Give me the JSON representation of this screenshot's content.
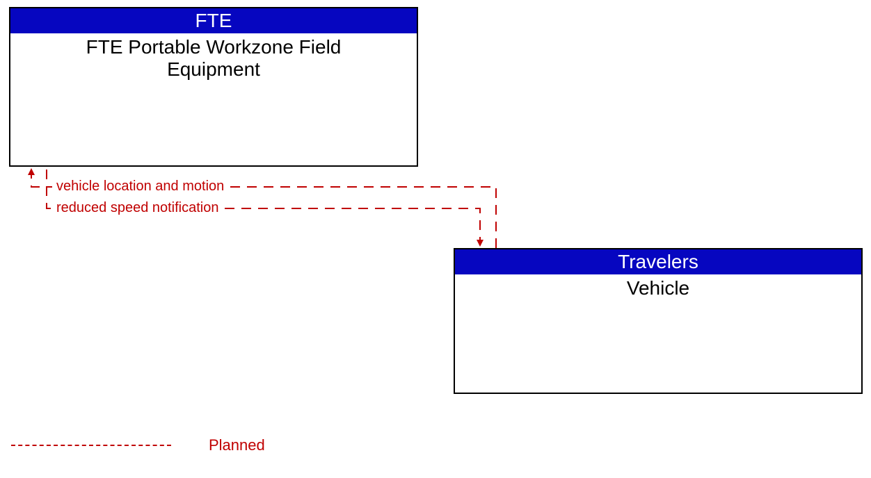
{
  "box1": {
    "header": "FTE",
    "body_line1": "FTE Portable Workzone Field",
    "body_line2": "Equipment"
  },
  "box2": {
    "header": "Travelers",
    "body": "Vehicle"
  },
  "flows": {
    "flow_up": "vehicle location and motion",
    "flow_down": "reduced speed notification"
  },
  "legend": {
    "planned": "Planned"
  }
}
